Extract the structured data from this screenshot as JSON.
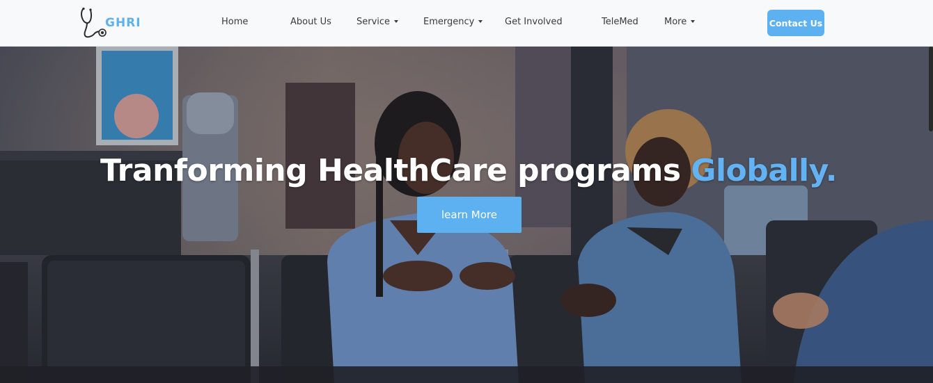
{
  "brand": {
    "name": "GHRI"
  },
  "nav": {
    "items": [
      {
        "label": "Home",
        "dropdown": false
      },
      {
        "label": "About Us",
        "dropdown": false
      },
      {
        "label": "Service",
        "dropdown": true
      },
      {
        "label": "Emergency",
        "dropdown": true
      },
      {
        "label": "Get Involved",
        "dropdown": false
      },
      {
        "label": "TeleMed",
        "dropdown": false
      },
      {
        "label": "More",
        "dropdown": true
      }
    ],
    "contact_label": "Contact Us"
  },
  "hero": {
    "title_main": "Tranforming HealthCare programs",
    "title_accent": "Globally.",
    "button_label": "learn More"
  },
  "colors": {
    "accent": "#5db1f1",
    "nav_bg": "#f8f9fb",
    "hero_text": "#ffffff"
  }
}
